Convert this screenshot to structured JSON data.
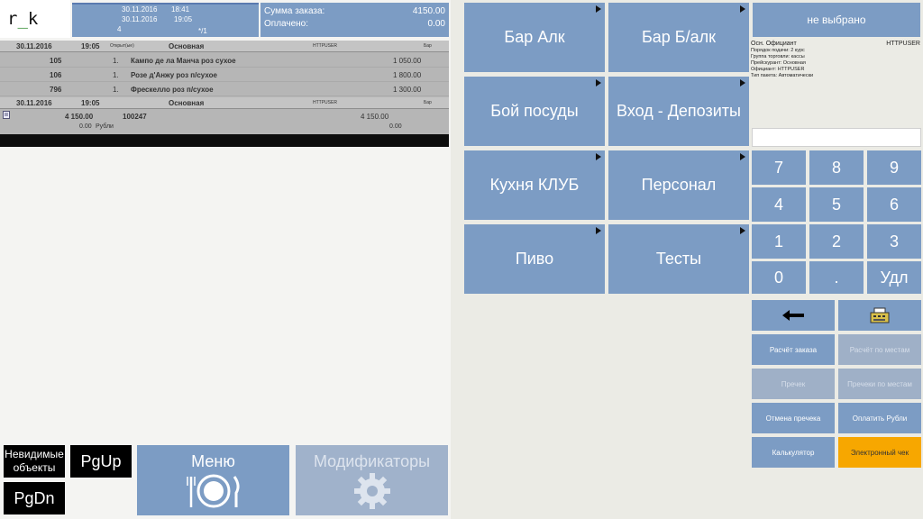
{
  "logo": {
    "text_r": "r",
    "text_u": "_",
    "text_k": "k"
  },
  "order_info": {
    "date1": "30.11.2016",
    "time1": "18:41",
    "date2": "30.11.2016",
    "time2": "19:05",
    "guests": "4",
    "table": "*/1"
  },
  "sums": {
    "order_label": "Сумма заказа:",
    "order_value": "4150.00",
    "paid_label": "Оплачено:",
    "paid_value": "0.00"
  },
  "order_list": {
    "header1": {
      "date": "30.11.2016",
      "time": "19:05",
      "opened": "Открыт(ые)",
      "name": "Основная",
      "user": "HTTPUSER",
      "place": "Бар"
    },
    "items": [
      {
        "code": "105",
        "qty": "1.",
        "name": "Кампо де ла Манча роз сухое",
        "price": "1 050.00"
      },
      {
        "code": "106",
        "qty": "1.",
        "name": "Розе д'Анжу роз п/сухое",
        "price": "1 800.00"
      },
      {
        "code": "796",
        "qty": "1.",
        "name": "Фрескелло роз п/сухое",
        "price": "1 300.00"
      }
    ],
    "header2": {
      "date": "30.11.2016",
      "time": "19:05",
      "name": "Основная",
      "user": "HTTPUSER",
      "place": "Бар"
    },
    "total": {
      "sum": "4 150.00",
      "number": "100247",
      "sum2": "4 150.00"
    },
    "paid": {
      "value": "0.00",
      "currency": "Рубли",
      "value2": "0.00"
    }
  },
  "bottom": {
    "invisible_line1": "Невидимые",
    "invisible_line2": "объекты",
    "pgup": "PgUp",
    "pgdn": "PgDn",
    "menu": "Меню",
    "modifiers": "Модификаторы"
  },
  "categories": [
    "Бар Алк",
    "Бар Б/алк",
    "Бой посуды",
    "Вход - Депозиты",
    "Кухня КЛУБ",
    "Персонал",
    "Пиво",
    "Тесты"
  ],
  "right": {
    "waiter_button": "не выбрано",
    "waiter_label": "Осн. Официант",
    "waiter_value": "HTTPUSER",
    "info_lines": [
      "Порядок подачи: 2 курс",
      "Группа торговли: кассы",
      "Прейскурант: Основная",
      "Официант: HTTPUSER",
      "Тип пакета: Автоматически"
    ],
    "numpad": [
      "7",
      "8",
      "9",
      "4",
      "5",
      "6",
      "1",
      "2",
      "3",
      "0",
      ".",
      "Удл"
    ],
    "back_icon": "arrow-left-icon",
    "calc_icon": "cash-register-icon",
    "actions": [
      {
        "label": "Расчёт заказа",
        "enabled": true
      },
      {
        "label": "Расчёт по местам",
        "enabled": false
      },
      {
        "label": "Пречек",
        "enabled": false
      },
      {
        "label": "Пречеки по местам",
        "enabled": false
      },
      {
        "label": "Отмена пречека",
        "enabled": true
      },
      {
        "label": "Оплатить Рубли",
        "enabled": true
      },
      {
        "label": "Калькулятор",
        "enabled": true
      },
      {
        "label": "Электронный чек",
        "enabled": true
      }
    ]
  },
  "colors": {
    "accent": "#7c9cc4",
    "orange": "#f7a700",
    "bg": "#ebebe5"
  }
}
